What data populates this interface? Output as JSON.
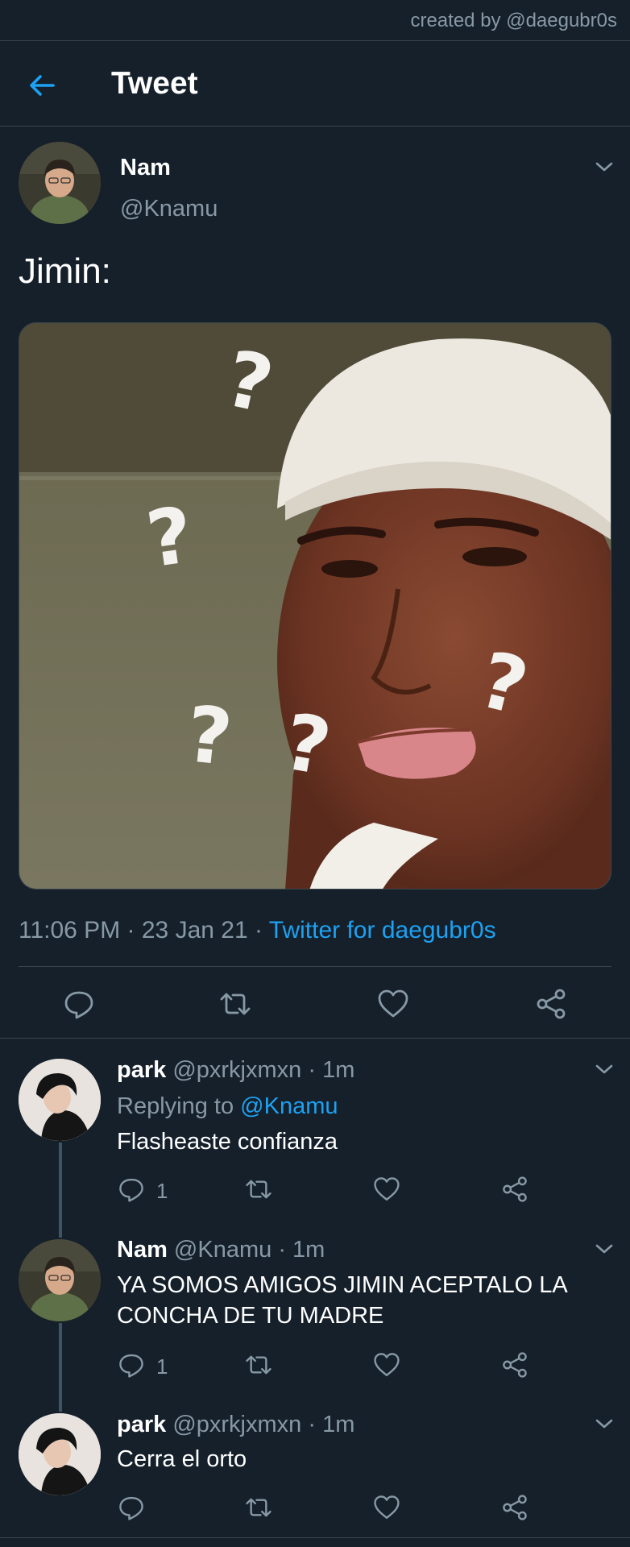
{
  "watermark": "created by @daegubr0s",
  "header": {
    "title": "Tweet"
  },
  "tweet": {
    "author_name": "Nam",
    "author_handle": "@Knamu",
    "text": "Jimin:",
    "time": "11:06 PM",
    "date": "23 Jan 21",
    "source": "Twitter for daegubr0s",
    "dot": "·"
  },
  "replies": [
    {
      "name": "park",
      "handle": "@pxrkjxmxn",
      "time": "1m",
      "replying_prefix": "Replying to",
      "replying_to": "@Knamu",
      "text": "Flasheaste confianza",
      "reply_count": "1"
    },
    {
      "name": "Nam",
      "handle": "@Knamu",
      "time": "1m",
      "text_line1": "YA SOMOS AMIGOS JIMIN ACEPTALO LA",
      "text_line2": "CONCHA DE TU MADRE",
      "reply_count": "1"
    },
    {
      "name": "park",
      "handle": "@pxrkjxmxn",
      "time": "1m",
      "text": "Cerra el orto"
    }
  ],
  "colors": {
    "background": "#15202b",
    "accent": "#1da1f2",
    "muted": "#8899a6",
    "divider": "#38444d"
  },
  "icons": [
    "back-arrow-icon",
    "chevron-down-icon",
    "reply-icon",
    "retweet-icon",
    "like-icon",
    "share-icon"
  ]
}
